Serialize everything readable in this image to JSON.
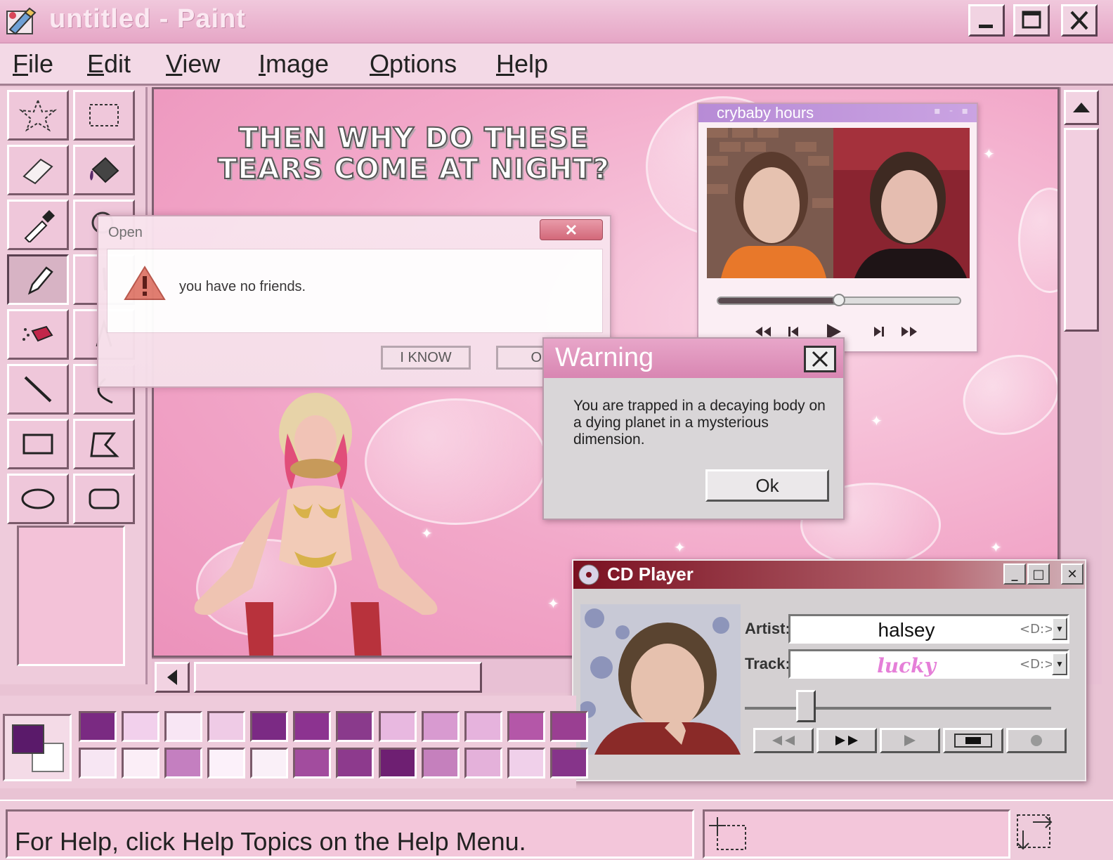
{
  "window": {
    "title": "untitled - Paint",
    "controls": [
      "minimize",
      "maximize",
      "close"
    ]
  },
  "menu": {
    "items": [
      {
        "label": "File"
      },
      {
        "label": "Edit"
      },
      {
        "label": "View"
      },
      {
        "label": "Image"
      },
      {
        "label": "Options"
      },
      {
        "label": "Help"
      }
    ]
  },
  "toolbox": {
    "tools": [
      "free-select",
      "rect-select",
      "eraser",
      "fill",
      "color-picker",
      "magnifier",
      "pencil",
      "brush",
      "airbrush",
      "text",
      "line",
      "curve",
      "rectangle",
      "polygon",
      "ellipse",
      "rounded-rectangle"
    ],
    "active_tool": "pencil"
  },
  "canvas": {
    "headline_line1": "THEN WHY DO THESE",
    "headline_line2": "TEARS COME AT NIGHT?"
  },
  "music_player": {
    "title": "crybaby hours",
    "progress": 0.5,
    "controls": [
      "rewind",
      "previous",
      "play",
      "next",
      "fast-forward"
    ]
  },
  "open_dialog": {
    "title": "Open",
    "message": "you have no friends.",
    "button_iknow": "I KNOW",
    "button_ok": "OK"
  },
  "warning_dialog": {
    "title": "Warning",
    "message": "You are trapped in a decaying body on a dying planet in a mysterious dimension.",
    "button_ok": "Ok"
  },
  "cd_player": {
    "title": "CD Player",
    "artist_label": "Artist:",
    "artist": "halsey",
    "track_label": "Track:",
    "track": "lucky",
    "field_tag": "<D:>",
    "volume": 0.2,
    "controls": [
      "rewind",
      "fast-forward",
      "play",
      "stop",
      "record"
    ]
  },
  "palette": {
    "foreground": "#5a1a6a",
    "background": "#ffffff",
    "colors": [
      "#7a2a82",
      "#f2d0ec",
      "#f8e6f4",
      "#efcbe6",
      "#7b2a84",
      "#8c3390",
      "#8a3a8c",
      "#e8b8e0",
      "#d89ad0",
      "#e6b3dd",
      "#b457a8",
      "#9a3f92",
      "#f7e6f3",
      "#fbeef7",
      "#c47fc0",
      "#fcf1fa",
      "#faf0f8",
      "#a24c9e",
      "#8d3a8d",
      "#6e1f72",
      "#c580bd",
      "#e4b1da",
      "#f0d0ea",
      "#86348a"
    ]
  },
  "status_bar": {
    "text": "For Help, click Help Topics on the Help Menu."
  }
}
